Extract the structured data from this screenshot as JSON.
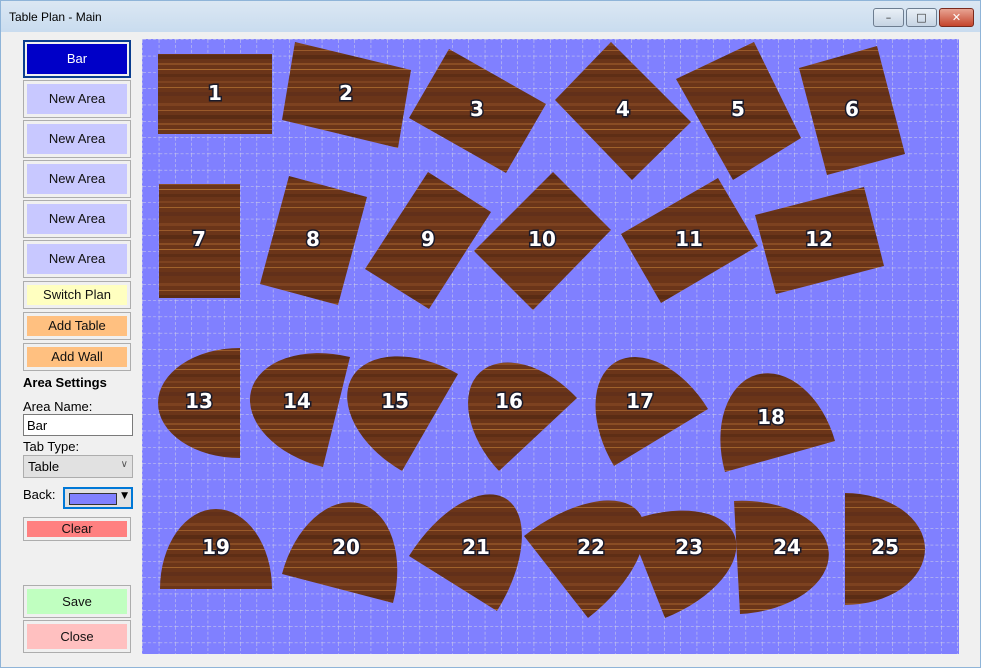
{
  "window": {
    "title": "Table Plan - Main",
    "controls": {
      "minimize": "–",
      "maximize": "□",
      "close": "✕"
    }
  },
  "sidebar": {
    "areas": [
      {
        "label": "Bar",
        "selected": true
      },
      {
        "label": "New Area",
        "selected": false
      },
      {
        "label": "New Area",
        "selected": false
      },
      {
        "label": "New Area",
        "selected": false
      },
      {
        "label": "New Area",
        "selected": false
      },
      {
        "label": "New Area",
        "selected": false
      }
    ],
    "switch_plan": "Switch Plan",
    "add_table": "Add Table",
    "add_wall": "Add Wall",
    "settings_heading": "Area Settings",
    "area_name_label": "Area Name:",
    "area_name_value": "Bar",
    "tab_type_label": "Tab Type:",
    "tab_type_value": "Table",
    "back_label": "Back:",
    "back_color": "#8080ff",
    "clear": "Clear",
    "save": "Save",
    "close": "Close"
  },
  "colors": {
    "selected_area": "#0000c8",
    "area_button": "#c8c8ff",
    "switch_plan": "#ffffc0",
    "add_buttons": "#ffc080",
    "clear": "#ff8080",
    "save": "#c0ffc0",
    "close": "#ffc0c0",
    "canvas_bg": "#8080ff",
    "grid": "#d0d0e0"
  },
  "plan": {
    "tables": [
      {
        "number": "1",
        "shape": "rect"
      },
      {
        "number": "2",
        "shape": "rect"
      },
      {
        "number": "3",
        "shape": "rect"
      },
      {
        "number": "4",
        "shape": "rect"
      },
      {
        "number": "5",
        "shape": "rect"
      },
      {
        "number": "6",
        "shape": "rect"
      },
      {
        "number": "7",
        "shape": "rect"
      },
      {
        "number": "8",
        "shape": "rect"
      },
      {
        "number": "9",
        "shape": "rect"
      },
      {
        "number": "10",
        "shape": "rect"
      },
      {
        "number": "11",
        "shape": "rect"
      },
      {
        "number": "12",
        "shape": "rect"
      },
      {
        "number": "13",
        "shape": "half-round"
      },
      {
        "number": "14",
        "shape": "half-round"
      },
      {
        "number": "15",
        "shape": "half-round"
      },
      {
        "number": "16",
        "shape": "half-round"
      },
      {
        "number": "17",
        "shape": "half-round"
      },
      {
        "number": "18",
        "shape": "half-round"
      },
      {
        "number": "19",
        "shape": "half-round"
      },
      {
        "number": "20",
        "shape": "half-round"
      },
      {
        "number": "21",
        "shape": "half-round"
      },
      {
        "number": "22",
        "shape": "half-round"
      },
      {
        "number": "23",
        "shape": "half-round"
      },
      {
        "number": "24",
        "shape": "half-round"
      },
      {
        "number": "25",
        "shape": "half-round"
      }
    ]
  }
}
